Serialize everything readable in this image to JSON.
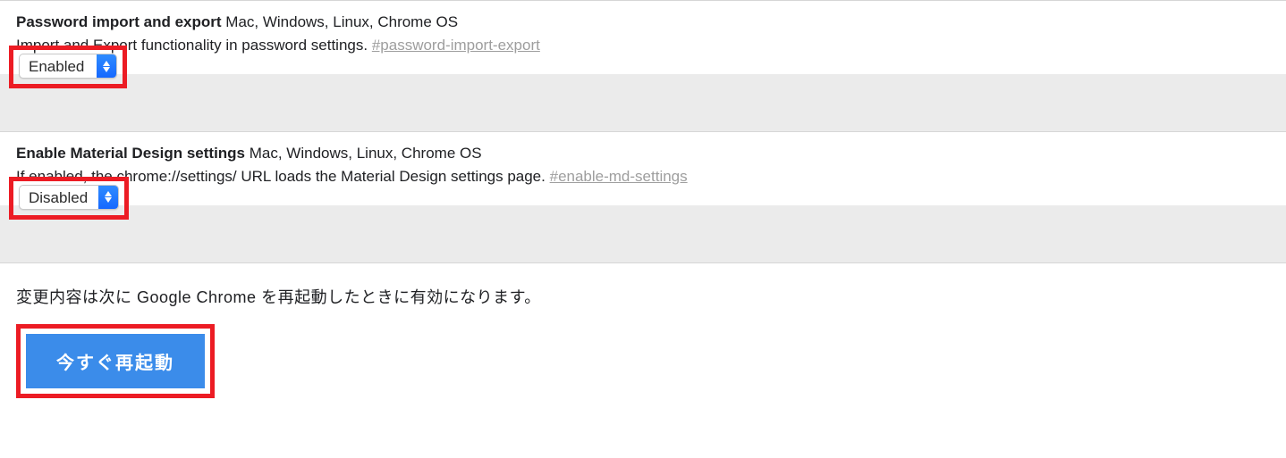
{
  "flags": [
    {
      "title": "Password import and export",
      "platforms": "Mac, Windows, Linux, Chrome OS",
      "description": "Import and Export functionality in password settings.",
      "anchor": "#password-import-export",
      "selected": "Enabled"
    },
    {
      "title": "Enable Material Design settings",
      "platforms": "Mac, Windows, Linux, Chrome OS",
      "description": "If enabled, the chrome://settings/ URL loads the Material Design settings page.",
      "anchor": "#enable-md-settings",
      "selected": "Disabled"
    }
  ],
  "restart": {
    "message": "変更内容は次に Google Chrome を再起動したときに有効になります。",
    "button": "今すぐ再起動"
  }
}
